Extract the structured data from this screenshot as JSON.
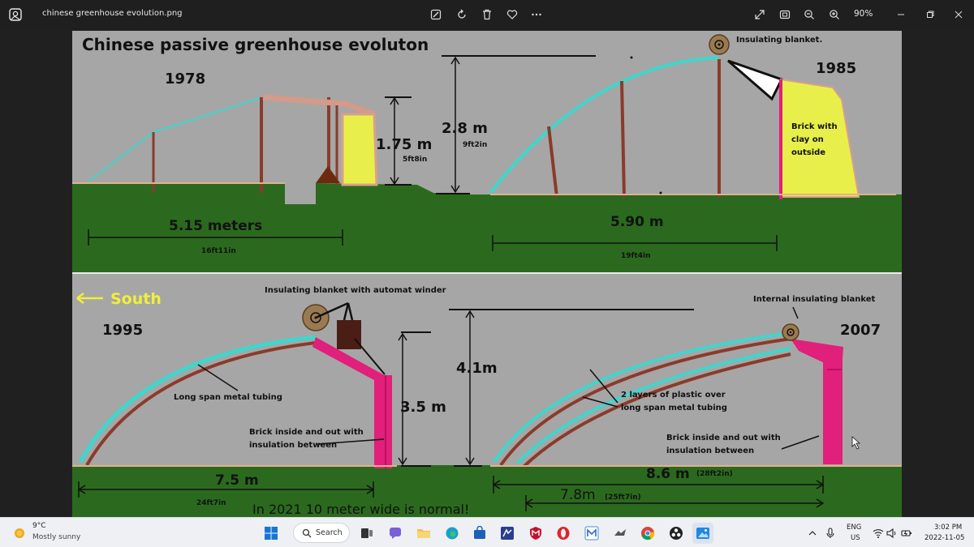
{
  "window": {
    "file_name": "chinese greenhouse evolution.png",
    "zoom": "90%"
  },
  "toolbar_icons": [
    "edit-image-icon",
    "rotate-icon",
    "delete-icon",
    "favorite-icon",
    "more-icon",
    "expand-icon",
    "fit-to-window-icon",
    "zoom-out-icon",
    "zoom-in-icon"
  ],
  "window_controls": [
    "minimize-icon",
    "maximize-icon",
    "close-icon"
  ],
  "image": {
    "title": "Chinese passive greenhouse evoluton",
    "panel_1978": {
      "year": "1978",
      "height": "1.75 m",
      "height_imperial": "5ft8in",
      "width": "5.15 meters",
      "width_imperial": "16ft11in"
    },
    "panel_1985": {
      "year": "1985",
      "blanket_label": "Insulating blanket.",
      "height": "2.8 m",
      "height_imperial": "9ft2in",
      "wall_label_1": "Brick with",
      "wall_label_2": "clay on",
      "wall_label_3": "outside",
      "width": "5.90 m",
      "width_imperial": "19ft4in"
    },
    "panel_1995": {
      "south_label": "South",
      "year": "1995",
      "winder_label": "Insulating blanket with automat winder",
      "tubing_label": "Long span metal tubing",
      "wall_label_1": "Brick inside and out with",
      "wall_label_2": "insulation between",
      "height": "3.5 m",
      "width": "7.5 m",
      "width_imperial": "24ft7in"
    },
    "panel_2007": {
      "year": "2007",
      "blanket_label": "Internal insulating blanket",
      "height": "4.1m",
      "plastic_label_1": "2 layers of plastic over",
      "plastic_label_2": "long span metal tubing",
      "wall_label_1": "Brick inside and out with",
      "wall_label_2": "insulation between",
      "width_outer": "8.6 m",
      "width_outer_imperial": "(28ft2in)",
      "width_inner": "7.8m",
      "width_inner_imperial": "(25ft7in)"
    },
    "footer_note": "In 2021  10 meter  wide is normal!",
    "colors": {
      "sky": "#a6a6a6",
      "ground": "#2b6a1e",
      "plastic": "#3fd6cc",
      "frame": "#8a3b2a",
      "wall_yellow": "#e9ef4a",
      "wall_pink": "#e0207a",
      "south_label": "#f2ee3b"
    }
  },
  "taskbar": {
    "weather_temp": "9°C",
    "weather_condition": "Mostly sunny",
    "search_label": "Search",
    "apps": [
      "file-explorer-icon",
      "chat-icon",
      "folder-icon",
      "edge-icon",
      "store-icon",
      "app-icon",
      "mcafee-icon",
      "opera-icon",
      "maxthon-icon",
      "app-icon",
      "chrome-icon",
      "obs-icon",
      "photos-icon"
    ],
    "language": "ENG",
    "region": "US",
    "time": "3:02 PM",
    "date": "2022-11-05"
  }
}
